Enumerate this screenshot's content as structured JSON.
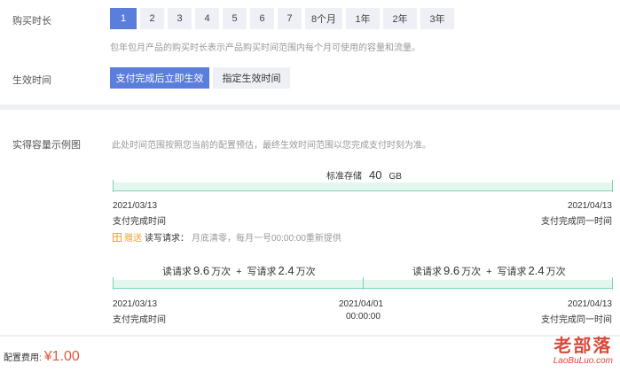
{
  "duration": {
    "label": "购买时长",
    "options": [
      "1",
      "2",
      "3",
      "4",
      "5",
      "6",
      "7",
      "8个月",
      "1年",
      "2年",
      "3年"
    ],
    "selected": "1",
    "hint": "包年包月产品的购买时长表示产品购买时间范围内每个月可使用的容量和流量。"
  },
  "effective": {
    "label": "生效时间",
    "options": [
      "支付完成后立即生效",
      "指定生效时间"
    ],
    "selected": "支付完成后立即生效"
  },
  "example": {
    "label": "实得容量示例图",
    "hint": "此处时间范围按照您当前的配置预估，最终生效时间范围以您完成支付时刻为准。",
    "storage": {
      "prefix": "标准存储",
      "value": "40",
      "unit": "GB"
    },
    "start_date": "2021/03/13",
    "start_sub": "支付完成时间",
    "end_date": "2021/04/13",
    "end_sub": "支付完成同一时间",
    "gift_tag": "赠送",
    "gift_label": "读写请求：",
    "gift_desc": "月底清零，每月一号00:00:00重新提供",
    "req": {
      "read": "读请求",
      "read_num": "9.6",
      "unit": "万次",
      "plus": "+",
      "write": "写请求",
      "write_num": "2.4"
    },
    "mid_date": "2021/04/01",
    "mid_time": "00:00:00"
  },
  "fee": {
    "label": "配置费用:",
    "amount": "¥1.00"
  },
  "watermark": {
    "title": "老部落",
    "url": "LaoBuLuo.com"
  },
  "colors": {
    "accent": "#5b7ddb",
    "bar": "#7dd3b1",
    "price": "#e0593a",
    "gift": "#f0a33a"
  }
}
